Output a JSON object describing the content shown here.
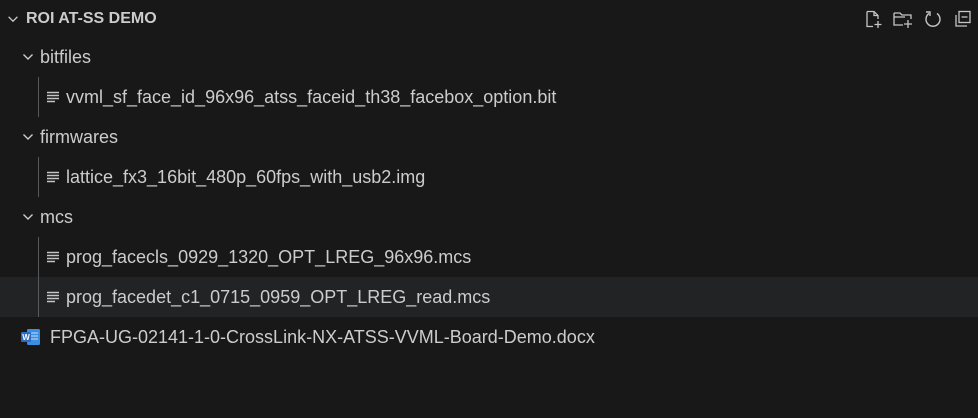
{
  "explorer": {
    "title": "ROI AT-SS DEMO",
    "actions": [
      {
        "icon": "new-file-icon",
        "label": "New File"
      },
      {
        "icon": "new-folder-icon",
        "label": "New Folder"
      },
      {
        "icon": "refresh-icon",
        "label": "Refresh Explorer"
      },
      {
        "icon": "collapse-all-icon",
        "label": "Collapse Folders in Explorer"
      }
    ]
  },
  "tree": {
    "folders": [
      {
        "name": "bitfiles",
        "expanded": true,
        "files": [
          {
            "name": "vvml_sf_face_id_96x96_atss_faceid_th38_facebox_option.bit",
            "icon": "text-file-icon"
          }
        ]
      },
      {
        "name": "firmwares",
        "expanded": true,
        "files": [
          {
            "name": "lattice_fx3_16bit_480p_60fps_with_usb2.img",
            "icon": "text-file-icon"
          }
        ]
      },
      {
        "name": "mcs",
        "expanded": true,
        "files": [
          {
            "name": "prog_facecls_0929_1320_OPT_LREG_96x96.mcs",
            "icon": "text-file-icon"
          },
          {
            "name": "prog_facedet_c1_0715_0959_OPT_LREG_read.mcs",
            "icon": "text-file-icon",
            "hovered": true
          }
        ]
      }
    ],
    "root_files": [
      {
        "name": "FPGA-UG-02141-1-0-CrossLink-NX-ATSS-VVML-Board-Demo.docx",
        "icon": "word-doc-icon"
      }
    ]
  },
  "colors": {
    "background": "#181818",
    "text": "#cccccc",
    "hover_row": "#222325",
    "indent_guide": "#585858",
    "word_icon": "#3c8ee3"
  }
}
